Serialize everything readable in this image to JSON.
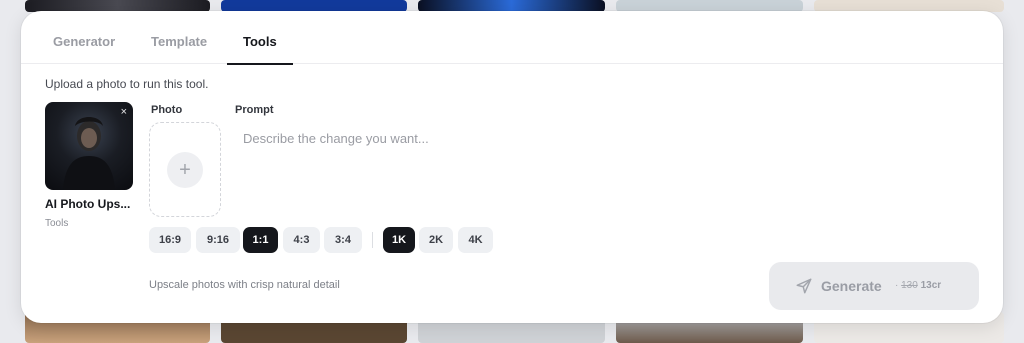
{
  "tabs": [
    {
      "label": "Generator"
    },
    {
      "label": "Template"
    },
    {
      "label": "Tools"
    }
  ],
  "active_tab": "Tools",
  "hint": "Upload a photo to run this tool.",
  "tool": {
    "name": "AI Photo Ups...",
    "category": "Tools",
    "close_icon": "×"
  },
  "labels": {
    "photo": "Photo",
    "prompt": "Prompt"
  },
  "photo_upload": {
    "plus_icon": "+"
  },
  "prompt_input": {
    "value": "",
    "placeholder": "Describe the change you want..."
  },
  "aspect_ratios": [
    "16:9",
    "9:16",
    "1:1",
    "4:3",
    "3:4"
  ],
  "selected_aspect": "1:1",
  "resolutions": [
    "1K",
    "2K",
    "4K"
  ],
  "selected_resolution": "1K",
  "footnote": "Upscale photos with crisp natural detail",
  "generate": {
    "label": "Generate",
    "separator": "·",
    "old_price": "130",
    "new_price": "13cr"
  },
  "colors": {
    "accent": "#15171c",
    "chip_bg": "#eef0f3",
    "button_disabled": "#e9eaed"
  }
}
